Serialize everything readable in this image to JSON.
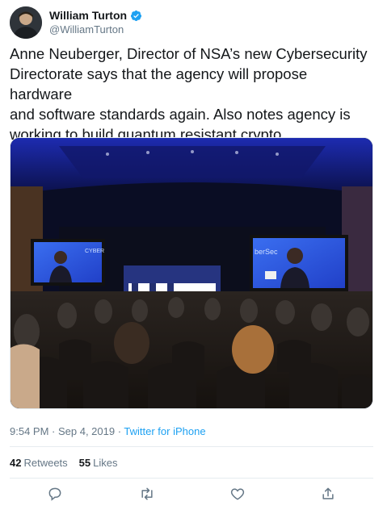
{
  "author": {
    "display_name": "William Turton",
    "handle": "@WilliamTurton",
    "verified_icon": "verified-badge-icon",
    "verified_color": "#1da1f2"
  },
  "tweet": {
    "text": "Anne Neuberger, Director of NSA’s new Cybersecurity\nDirectorate says that the agency will propose hardware\nand software standards again. Also notes agency is\nworking to build quantum resistant crypto.",
    "photo": {
      "screen_left_text": "CYBER",
      "screen_right_text": "berSec"
    }
  },
  "meta": {
    "timestamp": "9:54 PM · Sep 4, 2019 · ",
    "source": "Twitter for iPhone"
  },
  "stats": {
    "retweets_count": "42",
    "retweets_label": "Retweets",
    "likes_count": "55",
    "likes_label": "Likes"
  },
  "actions": {
    "reply_icon": "reply-icon",
    "retweet_icon": "retweet-icon",
    "like_icon": "heart-icon",
    "share_icon": "share-icon",
    "icon_color": "#657786"
  }
}
